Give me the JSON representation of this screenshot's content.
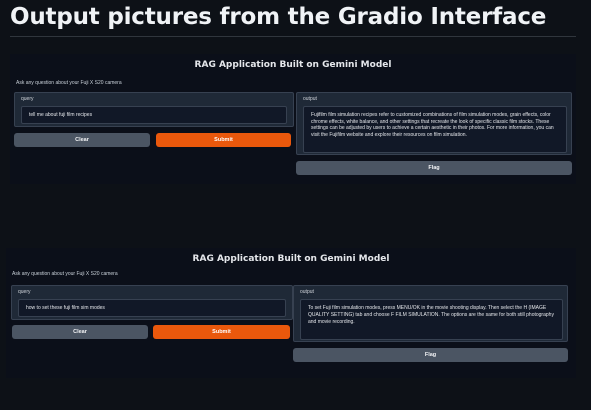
{
  "page_title": "Output pictures from the Gradio Interface",
  "apps": [
    {
      "title": "RAG Application Built on Gemini Model",
      "ask_text": "Ask any question about your Fuji X S20 camera",
      "query_label": "query",
      "query_value": "tell me about fuji film recipes",
      "output_label": "output",
      "output_value": "Fujifilm film simulation recipes refer to customized combinations of film simulation modes, grain effects, color chrome effects, white balance, and other settings that recreate the look of specific classic film stocks. These settings can be adjusted by users to achieve a certain aesthetic in their photos. For more information, you can visit the Fujifilm website and explore their resources on film simulation.",
      "clear_label": "Clear",
      "submit_label": "Submit",
      "flag_label": "Flag"
    },
    {
      "title": "RAG Application Built on Gemini Model",
      "ask_text": "Ask any question about your Fuji X S20 camera",
      "query_label": "query",
      "query_value": "how to set these fuji film sim modes",
      "output_label": "output",
      "output_value": "To set Fuji film simulation modes, press MENU/OK in the movie shooting display. Then select the H (IMAGE QUALITY SETTING) tab and choose F FILM SIMULATION. The options are the same for both still photography and movie recording.",
      "clear_label": "Clear",
      "submit_label": "Submit",
      "flag_label": "Flag"
    }
  ],
  "colors": {
    "background": "#0d1117",
    "panel": "#1f2937",
    "accent": "#ea580c",
    "secondary_button": "#4b5563"
  }
}
